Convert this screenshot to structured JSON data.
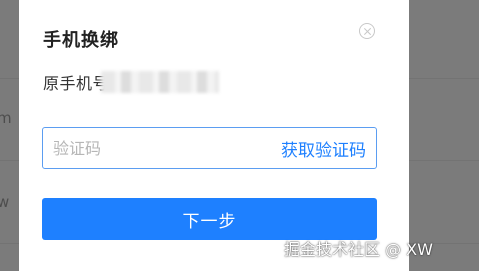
{
  "dialog": {
    "title": "手机换绑",
    "phone_label": "原手机号",
    "code_input": {
      "placeholder": "验证码",
      "value": ""
    },
    "get_code_label": "获取验证码",
    "next_label": "下一步",
    "close_icon": "close-circle-icon"
  },
  "background": {
    "fragment_1": "m",
    "fragment_2": "w"
  },
  "watermark": {
    "text": "掘金技术社区 @ XW"
  },
  "colors": {
    "accent": "#1e80ff",
    "input_border": "#5b9df1",
    "overlay": "#808080"
  }
}
